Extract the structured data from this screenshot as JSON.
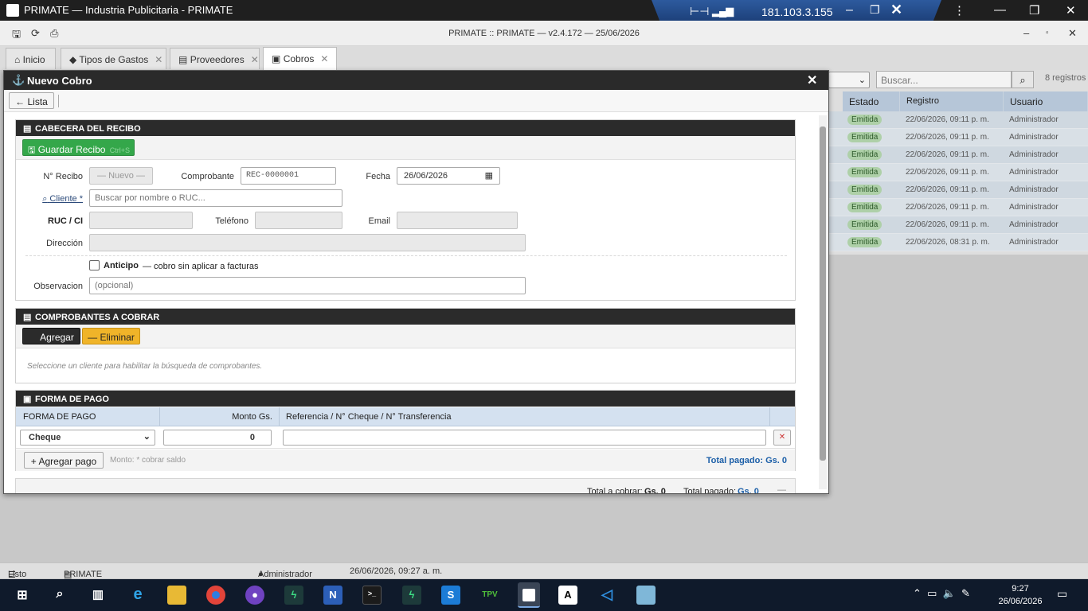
{
  "window": {
    "title": "PRIMATE — Industria Publicitaria - PRIMATE"
  },
  "remote": {
    "ip": "181.103.3.155"
  },
  "app": {
    "header_title": "PRIMATE :: PRIMATE — v2.4.172 — 25/06/2026"
  },
  "tabs": [
    {
      "label": "Inicio"
    },
    {
      "label": "Tipos de Gastos"
    },
    {
      "label": "Proveedores"
    },
    {
      "label": "Cobros"
    }
  ],
  "list": {
    "search_placeholder": "Buscar...",
    "count": "8 registros",
    "columns": [
      "Estado",
      "Registro",
      "Usuario"
    ],
    "rows": [
      {
        "estado": "Emitida",
        "registro": "22/06/2026, 09:11 p. m.",
        "usuario": "Administrador"
      },
      {
        "estado": "Emitida",
        "registro": "22/06/2026, 09:11 p. m.",
        "usuario": "Administrador"
      },
      {
        "estado": "Emitida",
        "registro": "22/06/2026, 09:11 p. m.",
        "usuario": "Administrador"
      },
      {
        "estado": "Emitida",
        "registro": "22/06/2026, 09:11 p. m.",
        "usuario": "Administrador"
      },
      {
        "estado": "Emitida",
        "registro": "22/06/2026, 09:11 p. m.",
        "usuario": "Administrador"
      },
      {
        "estado": "Emitida",
        "registro": "22/06/2026, 09:11 p. m.",
        "usuario": "Administrador"
      },
      {
        "estado": "Emitida",
        "registro": "22/06/2026, 09:11 p. m.",
        "usuario": "Administrador"
      },
      {
        "estado": "Emitida",
        "registro": "22/06/2026, 08:31 p. m.",
        "usuario": "Administrador"
      }
    ]
  },
  "modal": {
    "title": "Nuevo Cobro",
    "back_label": "Lista",
    "cabecera": {
      "title": "CABECERA DEL RECIBO",
      "save_label": "Guardar Recibo",
      "save_shortcut": "Ctrl+S",
      "nro_label": "N° Recibo",
      "nro_value": "— Nuevo —",
      "comprobante_label": "Comprobante",
      "comprobante_value": "REC-0000001",
      "fecha_label": "Fecha",
      "fecha_value": "26/06/2026",
      "cliente_label": "Cliente *",
      "cliente_placeholder": "Buscar por nombre o RUC...",
      "ruc_label": "RUC / CI",
      "telefono_label": "Teléfono",
      "email_label": "Email",
      "direccion_label": "Dirección",
      "anticipo_label": "Anticipo",
      "anticipo_desc": "— cobro sin aplicar a facturas",
      "observacion_label": "Observacion",
      "observacion_placeholder": "(opcional)"
    },
    "comprobantes": {
      "title": "COMPROBANTES A COBRAR",
      "add_label": "Agregar",
      "remove_label": "Eliminar",
      "hint": "Seleccione un cliente para habilitar la búsqueda de comprobantes."
    },
    "pago": {
      "title": "FORMA DE PAGO",
      "col_forma": "FORMA DE PAGO",
      "col_monto": "Monto Gs.",
      "col_ref": "Referencia / N° Cheque / N° Transferencia",
      "forma_value": "Cheque",
      "monto_value": "0",
      "add_label": "Agregar pago",
      "hint": "Monto: * cobrar saldo",
      "total_pagado": "Total pagado: Gs. 0"
    },
    "footer": {
      "total_cobrar_label": "Total a cobrar:",
      "total_cobrar_value": "Gs. 0",
      "total_pagado_label": "Total pagado:",
      "total_pagado_value": "Gs. 0"
    }
  },
  "status": {
    "ready": "Listo",
    "company": "PRIMATE INDUSTRIA PUBLICITARIA E.A.S.",
    "user": "Administrador",
    "datetime": "26/06/2026, 09:27 a. m."
  },
  "taskbar": {
    "time": "9:27",
    "date": "26/06/2026"
  }
}
